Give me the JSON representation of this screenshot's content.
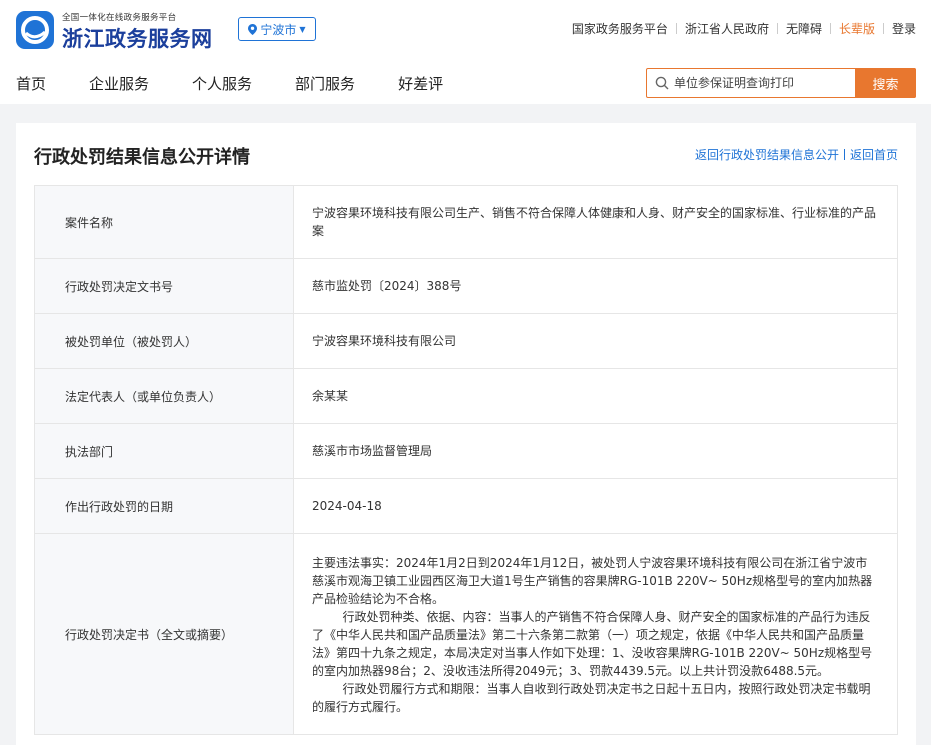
{
  "header": {
    "site_subtitle": "全国一体化在线政务服务平台",
    "site_title": "浙江政务服务网",
    "city": "宁波市",
    "links": [
      "国家政务服务平台",
      "浙江省人民政府",
      "无障碍",
      "长辈版",
      "登录"
    ]
  },
  "nav": {
    "items": [
      "首页",
      "企业服务",
      "个人服务",
      "部门服务",
      "好差评"
    ]
  },
  "search": {
    "placeholder": "单位参保证明查询打印",
    "button": "搜索"
  },
  "page": {
    "title": "行政处罚结果信息公开详情",
    "back_list": "返回行政处罚结果信息公开",
    "back_home": "返回首页"
  },
  "details": [
    {
      "label": "案件名称",
      "value": "宁波容果环境科技有限公司生产、销售不符合保障人体健康和人身、财产安全的国家标准、行业标准的产品案"
    },
    {
      "label": "行政处罚决定文书号",
      "value": "慈市监处罚〔2024〕388号"
    },
    {
      "label": "被处罚单位（被处罚人）",
      "value": "宁波容果环境科技有限公司"
    },
    {
      "label": "法定代表人（或单位负责人）",
      "value": "余某某"
    },
    {
      "label": "执法部门",
      "value": "慈溪市市场监督管理局"
    },
    {
      "label": "作出行政处罚的日期",
      "value": "2024-04-18"
    },
    {
      "label": "行政处罚决定书（全文或摘要）",
      "value": "主要违法事实：2024年1月2日到2024年1月12日，被处罚人宁波容果环境科技有限公司在浙江省宁波市慈溪市观海卫镇工业园西区海卫大道1号生产销售的容果牌RG-101B 220V~ 50Hz规格型号的室内加热器产品检验结论为不合格。\n        行政处罚种类、依据、内容：当事人的产销售不符合保障人身、财产安全的国家标准的产品行为违反了《中华人民共和国产品质量法》第二十六条第二款第（一）项之规定，依据《中华人民共和国产品质量法》第四十九条之规定，本局决定对当事人作如下处理：1、没收容果牌RG-101B 220V~ 50Hz规格型号的室内加热器98台；2、没收违法所得2049元；3、罚款4439.5元。以上共计罚没款6488.5元。\n        行政处罚履行方式和期限：当事人自收到行政处罚决定书之日起十五日内，按照行政处罚决定书载明的履行方式履行。"
    }
  ],
  "colors": {
    "brand_blue": "#1f73d6",
    "accent_orange": "#e8772f"
  }
}
